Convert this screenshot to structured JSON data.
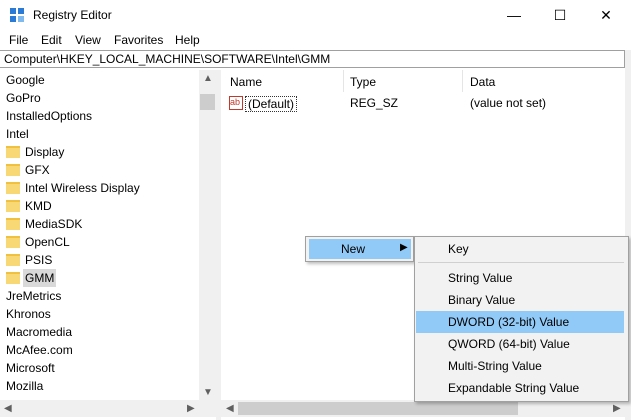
{
  "window": {
    "title": "Registry Editor",
    "minimize": "—",
    "maximize": "☐",
    "close": "✕"
  },
  "menu": [
    "File",
    "Edit",
    "View",
    "Favorites",
    "Help"
  ],
  "address": "Computer\\HKEY_LOCAL_MACHINE\\SOFTWARE\\Intel\\GMM",
  "tree": {
    "items": [
      {
        "label": "Google",
        "folder": false
      },
      {
        "label": "GoPro",
        "folder": false
      },
      {
        "label": "InstalledOptions",
        "folder": false
      },
      {
        "label": "Intel",
        "folder": false
      },
      {
        "label": "Display",
        "folder": true
      },
      {
        "label": "GFX",
        "folder": true
      },
      {
        "label": "Intel Wireless Display",
        "folder": true
      },
      {
        "label": "KMD",
        "folder": true
      },
      {
        "label": "MediaSDK",
        "folder": true
      },
      {
        "label": "OpenCL",
        "folder": true
      },
      {
        "label": "PSIS",
        "folder": true
      },
      {
        "label": "GMM",
        "folder": true,
        "selected": true
      },
      {
        "label": "JreMetrics",
        "folder": false
      },
      {
        "label": "Khronos",
        "folder": false
      },
      {
        "label": "Macromedia",
        "folder": false
      },
      {
        "label": "McAfee.com",
        "folder": false
      },
      {
        "label": "Microsoft",
        "folder": false
      },
      {
        "label": "Mozilla",
        "folder": false
      }
    ]
  },
  "list": {
    "columns": [
      "Name",
      "Type",
      "Data"
    ],
    "rows": [
      {
        "name": "(Default)",
        "type": "REG_SZ",
        "data": "(value not set)",
        "icon": "ab"
      }
    ]
  },
  "context_menu": {
    "new_label": "New",
    "submenu": [
      "Key",
      "String Value",
      "Binary Value",
      "DWORD (32-bit) Value",
      "QWORD (64-bit) Value",
      "Multi-String Value",
      "Expandable String Value"
    ],
    "highlighted": "DWORD (32-bit) Value"
  },
  "colors": {
    "highlight": "#91c9f7",
    "folder": "#f8d775"
  }
}
